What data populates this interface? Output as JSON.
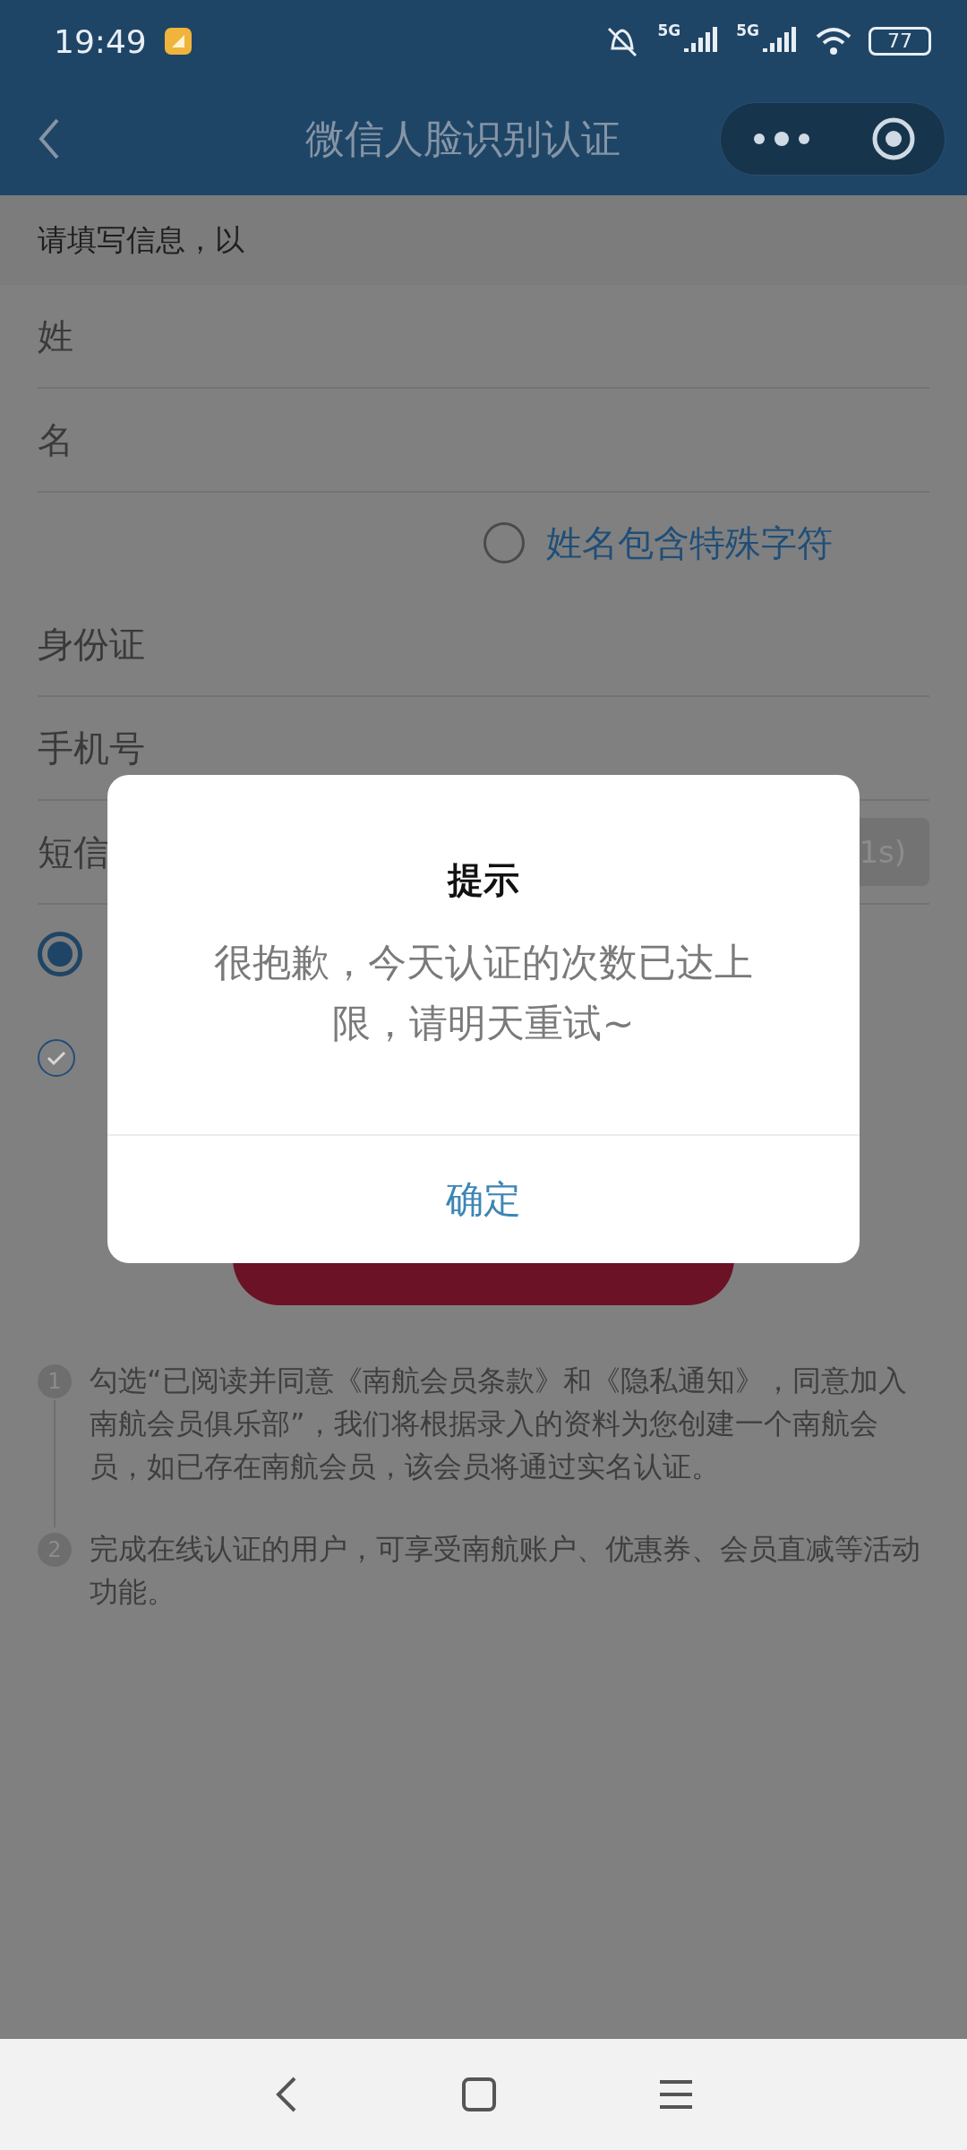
{
  "status_bar": {
    "time": "19:49",
    "networks": [
      "5G",
      "5G"
    ],
    "battery": "77"
  },
  "header": {
    "title": "微信人脸识别认证"
  },
  "notice": "请填写信息，以",
  "form": {
    "rows": [
      {
        "kind": "field",
        "label": "姓"
      },
      {
        "kind": "field",
        "label": "名"
      },
      {
        "kind": "option",
        "label": "姓名包含特殊字符",
        "checked": false
      },
      {
        "kind": "field",
        "label": "身份证"
      },
      {
        "kind": "field",
        "label": "手机号"
      },
      {
        "kind": "code",
        "label": "短信",
        "button": "1s)"
      }
    ]
  },
  "radio": {
    "selected": true
  },
  "agreement": {
    "checked": true
  },
  "steps": [
    {
      "number": "1",
      "text": "勾选“已阅读并同意《南航会员条款》和《隐私通知》，同意加入南航会员俱乐部”，我们将根据录入的资料为您创建一个南航会员，如已存在南航会员，该会员将通过实名认证。"
    },
    {
      "number": "2",
      "text": "完成在线认证的用户，可享受南航账户、优惠券、会员直减等活动功能。"
    }
  ],
  "dialog": {
    "title": "提示",
    "message": "很抱歉，今天认证的次数已达上限，请明天重试~",
    "button": "确定"
  }
}
